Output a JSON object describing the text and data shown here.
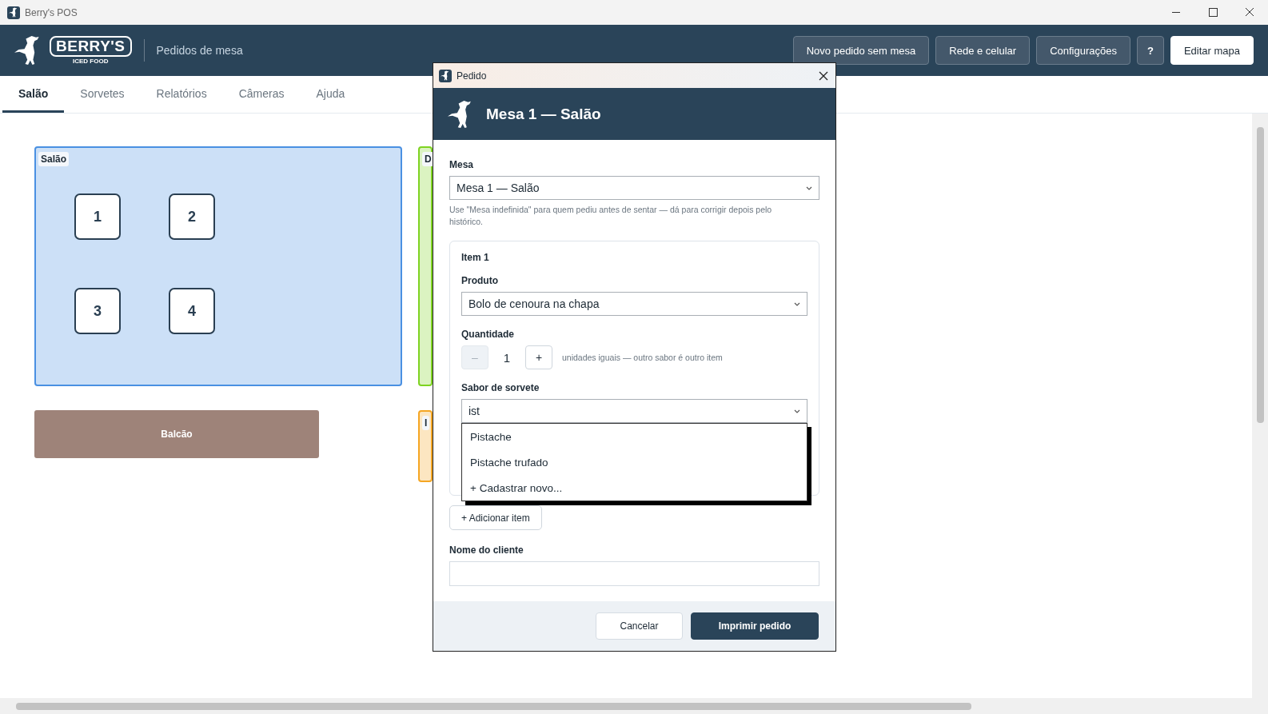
{
  "window": {
    "title": "Berry's POS"
  },
  "header": {
    "logo_text": "BERRY'S",
    "logo_subtext": "ICED FOOD",
    "page_title": "Pedidos de mesa",
    "buttons": [
      {
        "label": "Novo pedido sem mesa",
        "kind": "outline"
      },
      {
        "label": "Rede e celular",
        "kind": "outline"
      },
      {
        "label": "Configurações",
        "kind": "outline"
      },
      {
        "label": "?",
        "kind": "outline"
      },
      {
        "label": "Editar mapa",
        "kind": "primary"
      }
    ]
  },
  "tabs": [
    {
      "label": "Salão",
      "selected": true
    },
    {
      "label": "Sorvetes",
      "selected": false
    },
    {
      "label": "Relatórios",
      "selected": false
    },
    {
      "label": "Câmeras",
      "selected": false
    },
    {
      "label": "Ajuda",
      "selected": false
    }
  ],
  "floor_map": {
    "zones": [
      {
        "label": "Salão",
        "color": "#4a90e2",
        "tables": [
          "1",
          "2",
          "3",
          "4"
        ]
      },
      {
        "label": "D",
        "color": "#7ed321"
      },
      {
        "label": "I",
        "color": "#f5a623"
      }
    ],
    "counters": [
      {
        "label": "Balcão"
      }
    ]
  },
  "dialog": {
    "title": "Pedido",
    "heading": "Mesa 1 — Salão",
    "table_field": {
      "label": "Mesa",
      "value": "Mesa 1 — Salão",
      "hint": "Use \"Mesa indefinida\" para quem pediu antes de sentar — dá para corrigir depois pelo histórico."
    },
    "items": [
      {
        "title": "Item 1",
        "product": {
          "label": "Produto",
          "value": "Bolo de cenoura na chapa"
        },
        "quantity": {
          "label": "Quantidade",
          "value": "1",
          "decrement": "–",
          "decrement_disabled": true,
          "increment": "+",
          "note": "unidades iguais — outro sabor é outro item"
        },
        "flavor": {
          "label": "Sabor de sorvete",
          "value": "ist",
          "options": [
            "Pistache",
            "Pistache trufado",
            "+ Cadastrar novo..."
          ]
        }
      }
    ],
    "add_item": "+ Adicionar item",
    "customer": {
      "label": "Nome do cliente"
    },
    "buttons": [
      {
        "label": "Cancelar",
        "kind": "secondary"
      },
      {
        "label": "Imprimir pedido",
        "kind": "primary"
      }
    ]
  }
}
